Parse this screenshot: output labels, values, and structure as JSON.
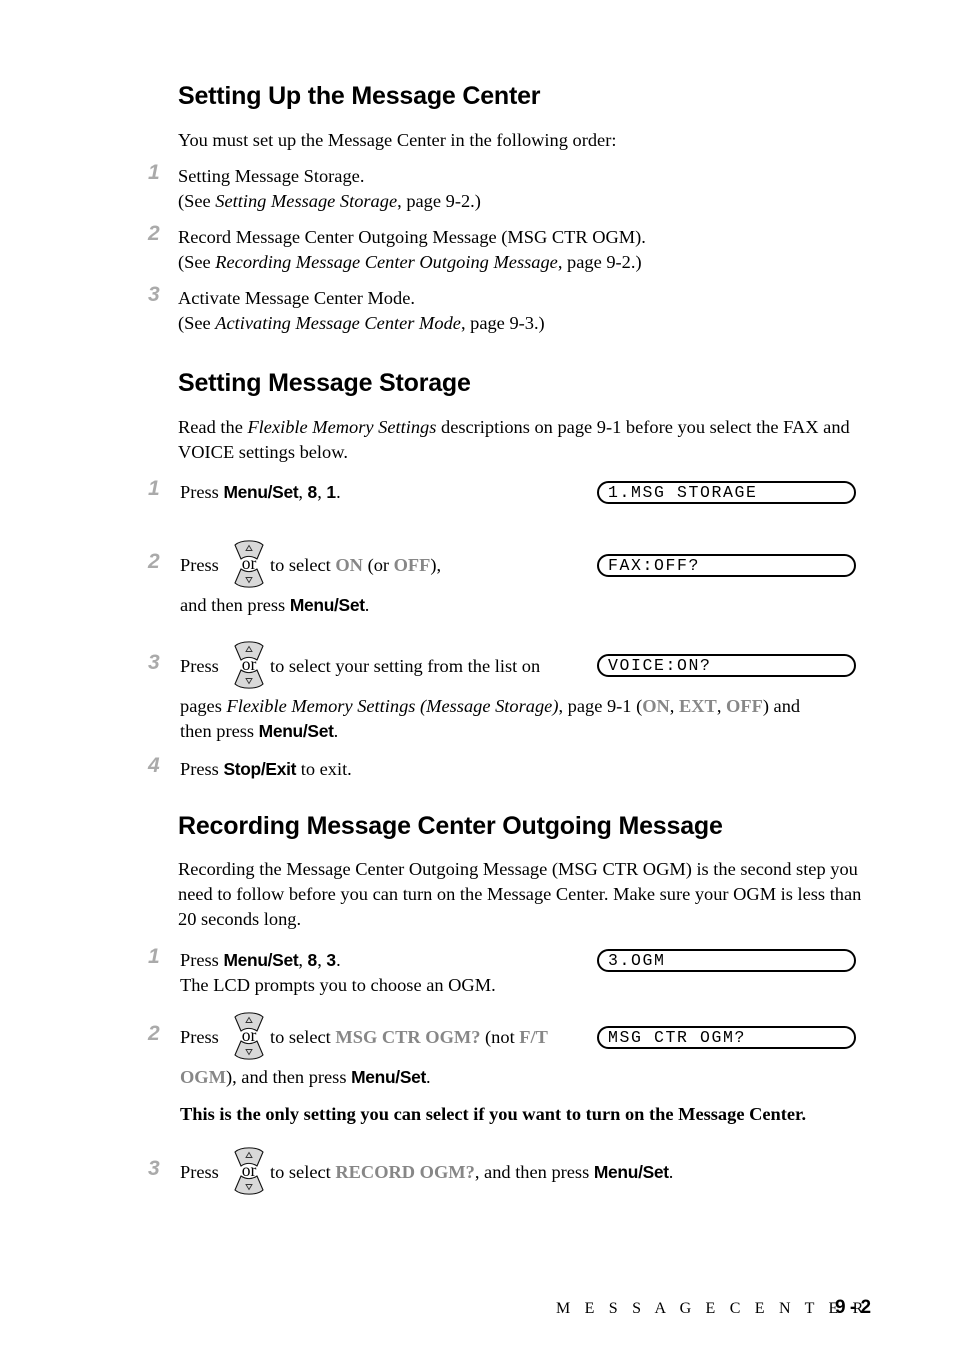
{
  "page": {
    "footer_section": "M E S S A G E   C E N T E R",
    "footer_page_number": "9 - 2",
    "accent_grey": "#878787",
    "number_grey": "#aaaaaa"
  },
  "sections": {
    "setup": {
      "heading": "Setting Up the Message Center",
      "intro": "You must set up the Message Center in the following order:",
      "steps": [
        {
          "number": "1",
          "line1": "Setting Message Storage.",
          "see_prefix": "(See ",
          "see_italic": "Setting Message Storage",
          "see_suffix": ", page 9-2.)"
        },
        {
          "number": "2",
          "line1": "Record Message Center Outgoing Message (MSG CTR OGM).",
          "see_prefix": "(See ",
          "see_italic": "Recording Message Center Outgoing Message",
          "see_suffix": ", page 9-2.)"
        },
        {
          "number": "3",
          "line1": "Activate Message Center Mode.",
          "see_prefix": "(See ",
          "see_italic": "Activating Message Center Mode",
          "see_suffix": ", page 9-3.)"
        }
      ]
    },
    "storage": {
      "heading": "Setting Message Storage",
      "intro_a": "Read the ",
      "intro_italic": "Flexible Memory Settings",
      "intro_b": " descriptions on page 9-1 before you select the FAX and VOICE settings below.",
      "step1": {
        "number": "1",
        "press": "Press ",
        "key": "Menu/Set",
        "comma1": ", ",
        "digit1": "8",
        "comma2": ", ",
        "digit2": "1",
        "period": "."
      },
      "step2": {
        "number": "2",
        "press": "Press ",
        "mid": " to select ",
        "value_on": "ON",
        "paren_open": " (or ",
        "value_off": "OFF",
        "paren_close": "),",
        "line2_a": "and then press ",
        "line2_key": "Menu/Set",
        "line2_b": "."
      },
      "step3": {
        "number": "3",
        "press": "Press ",
        "mid": " to select your setting from the list on",
        "line2_a": "pages ",
        "line2_italic": "Flexible Memory Settings (Message Storage)",
        "line2_b": ", page 9-1 (",
        "v1": "ON",
        "sep1": ", ",
        "v2": "EXT",
        "sep2": ", ",
        "v3": "OFF",
        "line2_c": ") and",
        "line3_a": "then press ",
        "line3_key": "Menu/Set",
        "line3_b": "."
      },
      "step4": {
        "number": "4",
        "press": "Press ",
        "key": "Stop/Exit",
        "suffix": " to exit."
      }
    },
    "recording": {
      "heading": "Recording Message Center Outgoing Message",
      "intro": "Recording the Message Center Outgoing Message (MSG CTR OGM) is the second step you need to follow before you can turn on the Message Center. Make sure your OGM is less than 20 seconds long.",
      "step1": {
        "number": "1",
        "press": "Press ",
        "key": "Menu/Set",
        "comma1": ", ",
        "digit1": "8",
        "comma2": ", ",
        "digit2": "3",
        "period": ".",
        "line2": "The LCD prompts you to choose an OGM."
      },
      "step2": {
        "number": "2",
        "press": "Press ",
        "mid": " to select ",
        "value": "MSG CTR OGM?",
        "not_open": " (not ",
        "not_value_a": "F/T",
        "not_value_b": "OGM",
        "after": "), and then press ",
        "key": "Menu/Set",
        "period": ".",
        "note": "This is the only setting you can select if you want to turn on the Message Center."
      },
      "step3": {
        "number": "3",
        "press": "Press ",
        "mid": " to select ",
        "value": "RECORD OGM?",
        "after": ", and then press ",
        "key": "Menu/Set",
        "period": "."
      }
    }
  },
  "lcd_displays": [
    {
      "id": "msg-storage",
      "text": "1.MSG STORAGE"
    },
    {
      "id": "fax-off",
      "text": "FAX:OFF?"
    },
    {
      "id": "voice-on",
      "text": "VOICE:ON?"
    },
    {
      "id": "ogm",
      "text": "3.OGM"
    },
    {
      "id": "msg-ctr-ogm",
      "text": "MSG CTR OGM?"
    }
  ],
  "icons": {
    "or_key_label": "or"
  }
}
